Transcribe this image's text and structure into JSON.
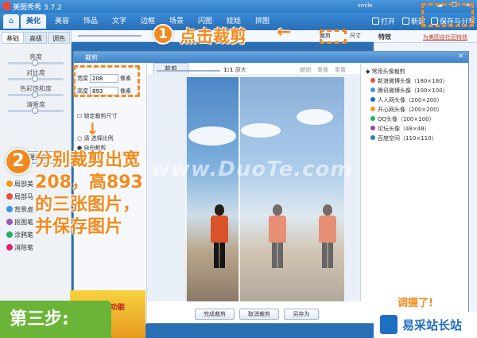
{
  "window": {
    "title": "美图秀秀 3.7.2",
    "user": "smile",
    "controls": "▬ ❐ ✕"
  },
  "tabs": [
    {
      "label": "美化",
      "active": true
    },
    {
      "label": "美容",
      "active": false
    },
    {
      "label": "饰品",
      "active": false
    },
    {
      "label": "文字",
      "active": false
    },
    {
      "label": "边框",
      "active": false
    },
    {
      "label": "场景",
      "active": false
    },
    {
      "label": "闪图",
      "active": false
    },
    {
      "label": "娃娃",
      "active": false
    },
    {
      "label": "拼图",
      "active": false
    }
  ],
  "top_actions": {
    "open": "打开",
    "new": "新建",
    "save_share": "保存与分享"
  },
  "left_panel": {
    "subtabs": [
      "基础",
      "高级",
      "调色"
    ],
    "sliders": [
      "亮度",
      "对比度",
      "色彩饱和度",
      "清晰度"
    ],
    "one_key": "一键美化",
    "features": [
      "局部美",
      "局部马",
      "背景虚",
      "抠图笔",
      "涂鸦笔",
      "消除笔"
    ],
    "banner": "美化和十十功能"
  },
  "toolbar": {
    "size": "尺寸",
    "crop": "裁剪"
  },
  "right_panel": {
    "special_label": "特效",
    "special_link": "为美图自社区特效"
  },
  "crop_dialog": {
    "header": "裁剪",
    "tab": "裁剪",
    "width_label": "宽度",
    "width_value": "208",
    "height_label": "高度",
    "height_value": "893",
    "unit": "像素",
    "lock_ratio": "锁定裁剪尺寸",
    "ratio_option": "请 选择比例",
    "free_crop": "自由裁剪",
    "zoom_label": "1:1",
    "zoom_text": "原大",
    "undo": "撤销",
    "redo": "重做",
    "reset": "重置",
    "presets_title": "常用头像裁剪",
    "presets": [
      "新浪微博头像（180×180）",
      "腾讯微博头像（100×100）",
      "人人网头像（200×200）",
      "开心网头像（200×200）",
      "QQ头像（100×100）",
      "论坛头像（48×48）",
      "百度空间（110×110）"
    ],
    "buttons": {
      "done": "完成裁剪",
      "cancel": "取消裁剪",
      "save_as": "另存为"
    }
  },
  "annotations": {
    "step1_num": "1",
    "step1_text": "点击裁剪",
    "arrow": "←",
    "step2_num": "2",
    "step2_lines": [
      "分别裁剪出宽",
      "208，高893",
      "的三张图片，",
      "并保存图片"
    ],
    "step_label": "第三步:"
  },
  "watermark": "www.DuoTe.com",
  "brand": {
    "name": "易采站长站",
    "bottom_banner": "调摄了!"
  }
}
